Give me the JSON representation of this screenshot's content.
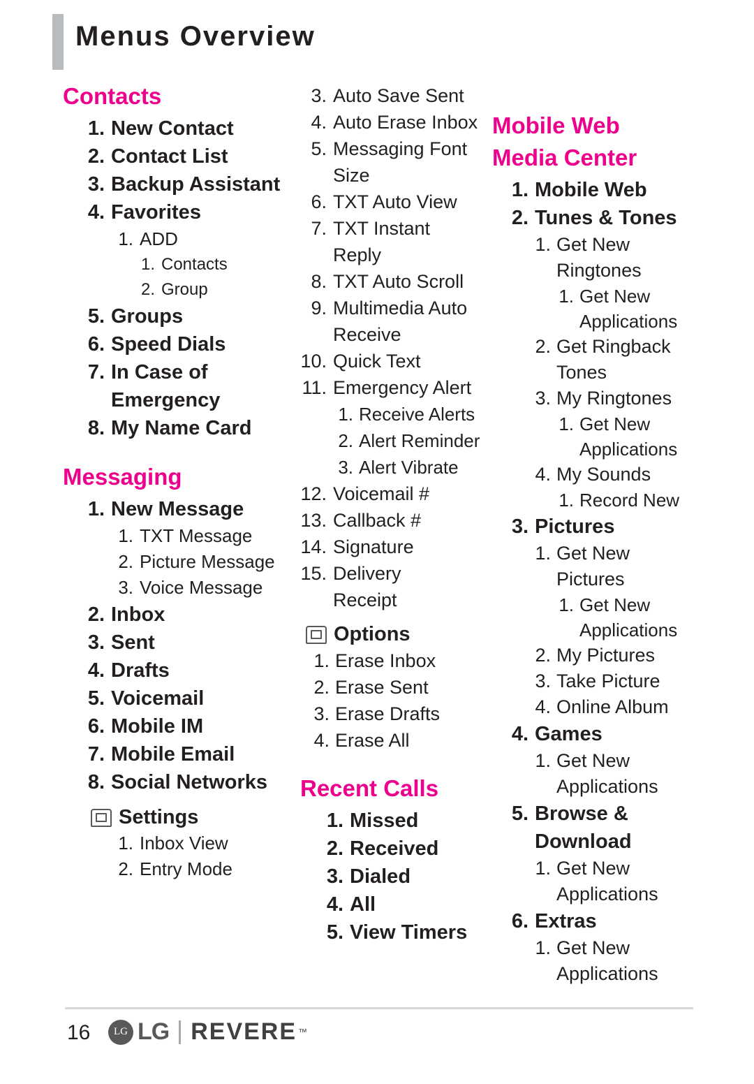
{
  "header": {
    "title": "Menus Overview"
  },
  "columns": {
    "col1": {
      "contacts": {
        "heading": "Contacts",
        "items": [
          {
            "num": "1.",
            "label": "New Contact",
            "level": 1
          },
          {
            "num": "2.",
            "label": "Contact List",
            "level": 1
          },
          {
            "num": "3.",
            "label": "Backup Assistant",
            "level": 1
          },
          {
            "num": "4.",
            "label": "Favorites",
            "level": 1
          },
          {
            "num": "1.",
            "label": "ADD",
            "level": 2
          },
          {
            "num": "1.",
            "label": "Contacts",
            "level": 3
          },
          {
            "num": "2.",
            "label": "Group",
            "level": 3
          },
          {
            "num": "5.",
            "label": "Groups",
            "level": 1
          },
          {
            "num": "6.",
            "label": "Speed Dials",
            "level": 1
          },
          {
            "num": "7.",
            "label": "In Case of",
            "level": 1,
            "cont": "Emergency"
          },
          {
            "num": "8.",
            "label": "My Name Card",
            "level": 1
          }
        ]
      },
      "messaging": {
        "heading": "Messaging",
        "items": [
          {
            "num": "1.",
            "label": "New Message",
            "level": 1
          },
          {
            "num": "1.",
            "label": "TXT Message",
            "level": 2
          },
          {
            "num": "2.",
            "label": "Picture Message",
            "level": 2
          },
          {
            "num": "3.",
            "label": "Voice Message",
            "level": 2
          },
          {
            "num": "2.",
            "label": "Inbox",
            "level": 1
          },
          {
            "num": "3.",
            "label": "Sent",
            "level": 1
          },
          {
            "num": "4.",
            "label": "Drafts",
            "level": 1
          },
          {
            "num": "5.",
            "label": "Voicemail",
            "level": 1
          },
          {
            "num": "6.",
            "label": "Mobile IM",
            "level": 1
          },
          {
            "num": "7.",
            "label": "Mobile Email",
            "level": 1
          },
          {
            "num": "8.",
            "label": "Social Networks",
            "level": 1
          }
        ],
        "settings": {
          "heading": "Settings",
          "icon": "softkey-icon",
          "items": [
            {
              "num": "1.",
              "label": "Inbox View"
            },
            {
              "num": "2.",
              "label": "Entry Mode"
            }
          ]
        }
      }
    },
    "col2": {
      "settings_continued": [
        {
          "num": "3.",
          "label": "Auto Save Sent"
        },
        {
          "num": "4.",
          "label": "Auto Erase Inbox"
        },
        {
          "num": "5.",
          "label": "Messaging Font",
          "cont": "Size"
        },
        {
          "num": "6.",
          "label": "TXT Auto View"
        },
        {
          "num": "7.",
          "label": "TXT Instant",
          "cont": "Reply"
        },
        {
          "num": "8.",
          "label": "TXT Auto Scroll"
        },
        {
          "num": "9.",
          "label": "Multimedia Auto",
          "cont": "Receive"
        },
        {
          "num": "10.",
          "label": "Quick Text"
        },
        {
          "num": "11.",
          "label": "Emergency Alert"
        },
        {
          "num": "12.",
          "label": "Voicemail #"
        },
        {
          "num": "13.",
          "label": "Callback #"
        },
        {
          "num": "14.",
          "label": "Signature"
        },
        {
          "num": "15.",
          "label": "Delivery",
          "cont": "Receipt"
        }
      ],
      "emergency_alert_subs": [
        {
          "num": "1.",
          "label": "Receive Alerts"
        },
        {
          "num": "2.",
          "label": "Alert Reminder"
        },
        {
          "num": "3.",
          "label": "Alert Vibrate"
        }
      ],
      "options": {
        "heading": "Options",
        "icon": "softkey-icon",
        "items": [
          {
            "num": "1.",
            "label": "Erase Inbox"
          },
          {
            "num": "2.",
            "label": "Erase Sent"
          },
          {
            "num": "3.",
            "label": "Erase Drafts"
          },
          {
            "num": "4.",
            "label": "Erase All"
          }
        ]
      },
      "recent_calls": {
        "heading": "Recent Calls",
        "items": [
          {
            "num": "1.",
            "label": "Missed"
          },
          {
            "num": "2.",
            "label": "Received"
          },
          {
            "num": "3.",
            "label": "Dialed"
          },
          {
            "num": "4.",
            "label": "All"
          },
          {
            "num": "5.",
            "label": "View Timers"
          }
        ]
      }
    },
    "col3": {
      "mobile_web": {
        "heading_line1": "Mobile Web",
        "heading_line2": "Media Center",
        "items": [
          {
            "num": "1.",
            "label": "Mobile Web",
            "level": 1
          },
          {
            "num": "2.",
            "label": "Tunes & Tones",
            "level": 1
          },
          {
            "num": "1.",
            "label": "Get New",
            "level": 2,
            "cont": "Ringtones"
          },
          {
            "num": "1.",
            "label": "Get New",
            "level": 3,
            "cont": "Applications"
          },
          {
            "num": "2.",
            "label": "Get Ringback",
            "level": 2,
            "cont": "Tones"
          },
          {
            "num": "3.",
            "label": "My Ringtones",
            "level": 2
          },
          {
            "num": "1.",
            "label": "Get New",
            "level": 3,
            "cont": "Applications"
          },
          {
            "num": "4.",
            "label": "My Sounds",
            "level": 2
          },
          {
            "num": "1.",
            "label": "Record New",
            "level": 3
          },
          {
            "num": "3.",
            "label": "Pictures",
            "level": 1
          },
          {
            "num": "1.",
            "label": "Get New Pictures",
            "level": 2
          },
          {
            "num": "1.",
            "label": "Get New",
            "level": 3,
            "cont": "Applications"
          },
          {
            "num": "2.",
            "label": "My Pictures",
            "level": 2
          },
          {
            "num": "3.",
            "label": "Take Picture",
            "level": 2
          },
          {
            "num": "4.",
            "label": "Online Album",
            "level": 2
          },
          {
            "num": "4.",
            "label": "Games",
            "level": 1
          },
          {
            "num": "1.",
            "label": "Get New",
            "level": 2,
            "cont": "Applications"
          },
          {
            "num": "5.",
            "label": "Browse &",
            "level": 1,
            "cont": "Download"
          },
          {
            "num": "1.",
            "label": "Get New",
            "level": 2,
            "cont": "Applications"
          },
          {
            "num": "6.",
            "label": "Extras",
            "level": 1
          },
          {
            "num": "1.",
            "label": "Get New",
            "level": 2,
            "cont": "Applications"
          }
        ]
      }
    }
  },
  "footer": {
    "page_number": "16",
    "brand_mark": "LG",
    "brand": "LG",
    "model": "REVERE",
    "trademark": "™"
  },
  "colors": {
    "accent_pink": "#ec008c",
    "text": "#231f20",
    "rule": "#d6d7d9",
    "header_bar": "#b9bcbe"
  }
}
